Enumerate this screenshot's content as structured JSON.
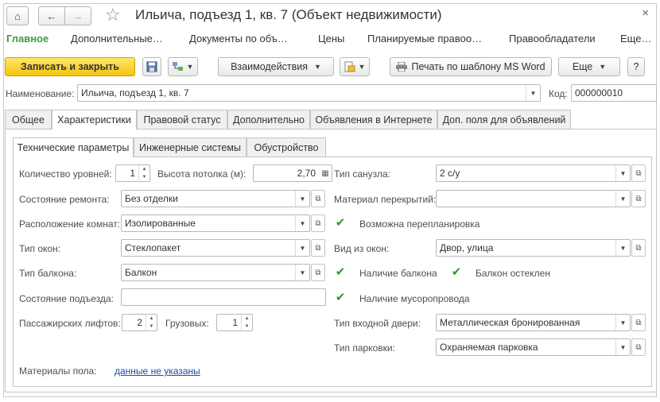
{
  "window": {
    "title": "Ильича, подъезд 1, кв. 7 (Объект недвижимости)",
    "close": "×",
    "home_glyph": "⌂",
    "back_glyph": "←",
    "forward_glyph": "→",
    "star_glyph": "☆"
  },
  "menu": {
    "items": [
      "Главное",
      "Дополнительные…",
      "Документы по объ…",
      "Цены",
      "Планируемые правоо…",
      "Правообладатели",
      "Еще…"
    ]
  },
  "toolbar": {
    "save_close": "Записать и закрыть",
    "interactions": "Взаимодействия",
    "print_word": "Печать по шаблону MS Word",
    "more": "Еще",
    "help": "?"
  },
  "header": {
    "name_label": "Наименование:",
    "name_value": "Ильича, подъезд 1, кв. 7",
    "code_label": "Код:",
    "code_value": "000000010"
  },
  "tabs": [
    "Общее",
    "Характеристики",
    "Правовой статус",
    "Дополнительно",
    "Объявления в Интернете",
    "Доп. поля для объявлений"
  ],
  "subtabs": [
    "Технические параметры",
    "Инженерные системы",
    "Обустройство"
  ],
  "left": {
    "levels_label": "Количество уровней:",
    "levels_value": "1",
    "ceiling_label": "Высота потолка (м):",
    "ceiling_value": "2,70",
    "repair_label": "Состояние ремонта:",
    "repair_value": "Без отделки",
    "rooms_label": "Расположение комнат:",
    "rooms_value": "Изолированные",
    "windows_label": "Тип окон:",
    "windows_value": "Стеклопакет",
    "balcony_label": "Тип балкона:",
    "balcony_value": "Балкон",
    "entrance_label": "Состояние подъезда:",
    "entrance_value": "",
    "pass_lifts_label": "Пассажирских лифтов:",
    "pass_lifts_value": "2",
    "cargo_lifts_label": "Грузовых:",
    "cargo_lifts_value": "1",
    "floor_label": "Материалы пола:",
    "floor_link": "данные не указаны"
  },
  "right": {
    "bathroom_label": "Тип санузла:",
    "bathroom_value": "2 с/у",
    "overlap_label": "Материал перекрытий:",
    "overlap_value": "",
    "replan_label": "Возможна перепланировка",
    "view_label": "Вид из окон:",
    "view_value": "Двор, улица",
    "has_balcony_label": "Наличие балкона",
    "balcony_glazed_label": "Балкон остеклен",
    "garbage_label": "Наличие мусоропровода",
    "door_label": "Тип входной двери:",
    "door_value": "Металлическая бронированная",
    "parking_label": "Тип парковки:",
    "parking_value": "Охраняемая парковка"
  },
  "checks": {
    "replan": true,
    "has_balcony": true,
    "balcony_glazed": true,
    "garbage": true
  },
  "colors": {
    "accent_green": "#3b9e3e",
    "primary_button": "#f5c40f",
    "link": "#1a4fa0"
  }
}
